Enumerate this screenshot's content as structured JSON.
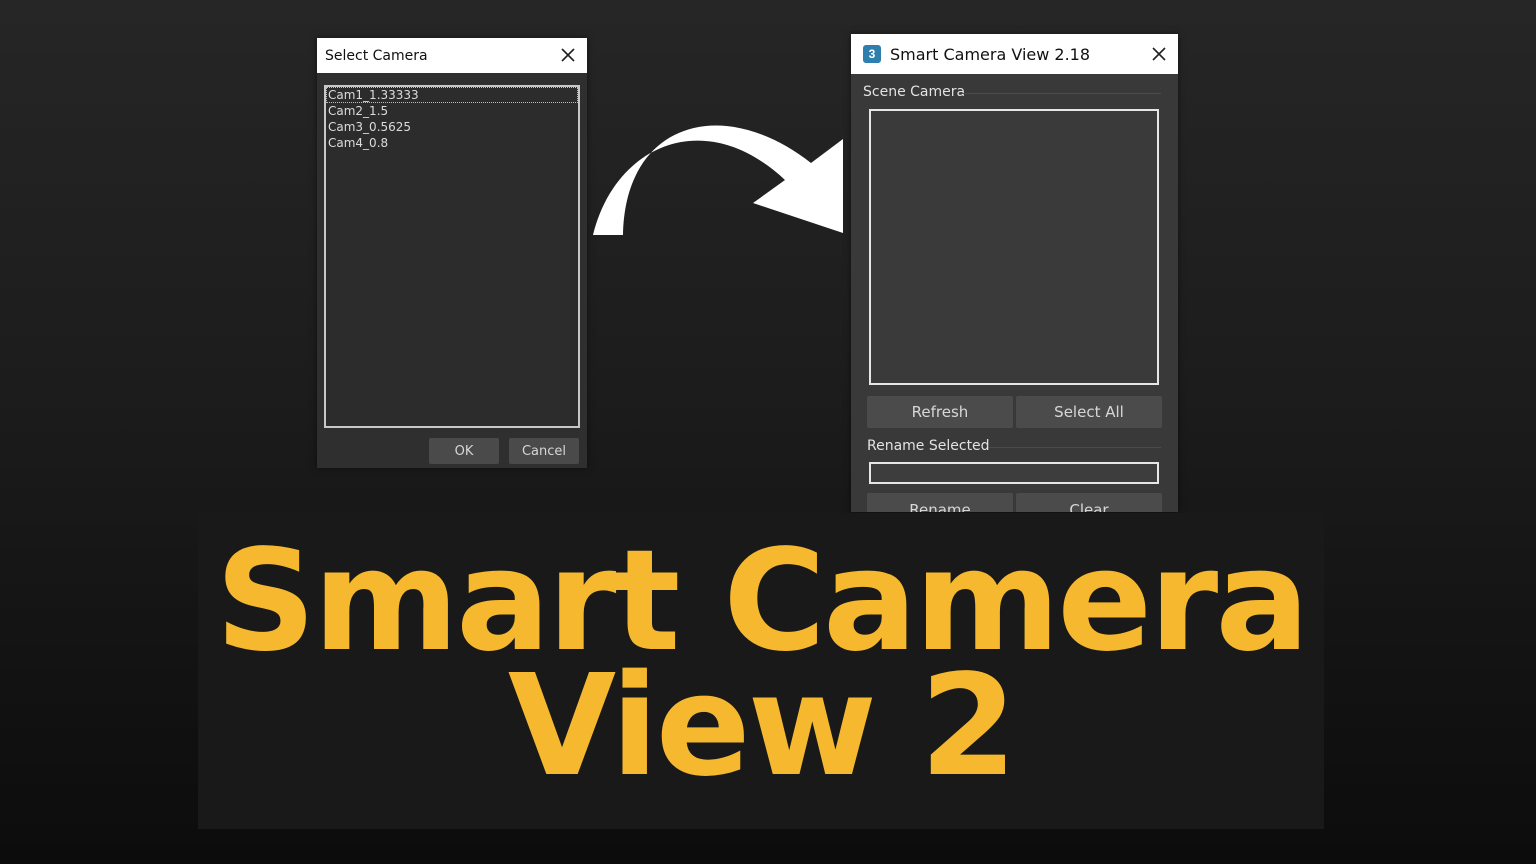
{
  "select_dialog": {
    "title": "Select Camera",
    "cameras": [
      "Cam1_1.33333",
      "Cam2_1.5",
      "Cam3_0.5625",
      "Cam4_0.8"
    ],
    "selected_index": 0,
    "ok_label": "OK",
    "cancel_label": "Cancel"
  },
  "smart_dialog": {
    "title": "Smart Camera View 2.18",
    "app_icon_glyph": "3",
    "scene_camera_label": "Scene Camera",
    "refresh_label": "Refresh",
    "select_all_label": "Select All",
    "rename_selected_label": "Rename Selected",
    "rename_label": "Rename",
    "clear_label": "Clear",
    "rename_value": ""
  },
  "banner": {
    "line1": "Smart Camera",
    "line2": "View 2"
  },
  "colors": {
    "headline": "#f5b82e",
    "app_icon": "#2f7fae"
  },
  "icons": {
    "close": "close-icon",
    "arrow": "curved-arrow-icon"
  }
}
